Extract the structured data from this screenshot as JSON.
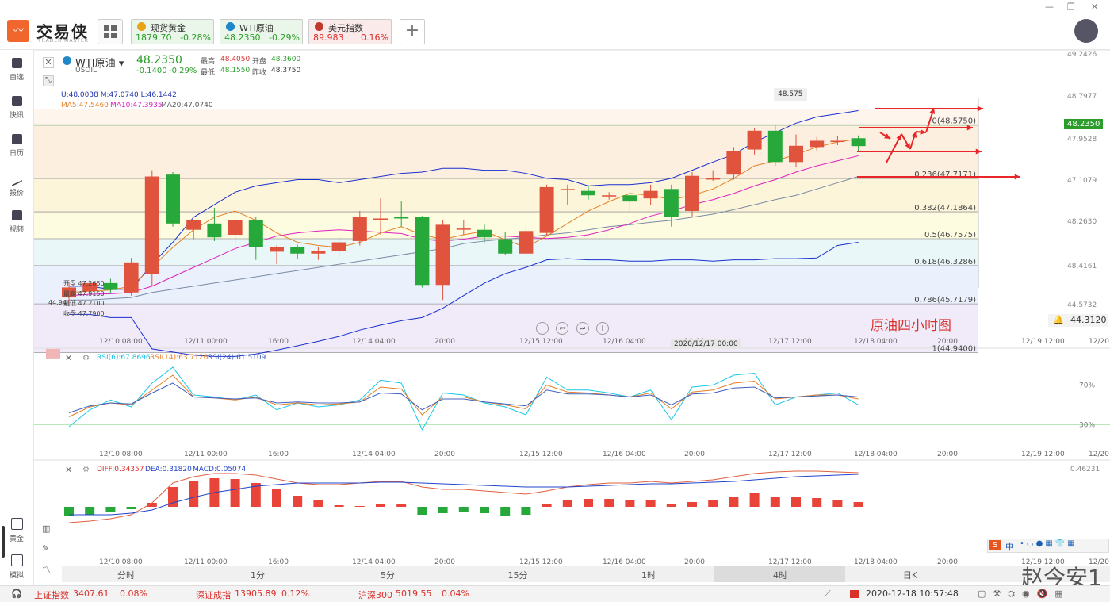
{
  "app": {
    "name": "交易侠",
    "sub": "TRADER MASTER"
  },
  "window": {
    "minimize": "—",
    "restore": "❐",
    "close": "✕"
  },
  "quotes": [
    {
      "name": "现货黄金",
      "price": "1879.70",
      "change": "-0.28%",
      "color": "#e8a317",
      "bg": "#eaf6ea",
      "pc": "#2a9d2a"
    },
    {
      "name": "WTI原油",
      "price": "48.2350",
      "change": "-0.29%",
      "color": "#1e88c8",
      "bg": "#eaf6ea",
      "pc": "#2a9d2a"
    },
    {
      "name": "美元指数",
      "price": "89.983",
      "change": "0.16%",
      "color": "#c0392b",
      "bg": "#fbeaea",
      "pc": "#d9302c"
    }
  ],
  "sidebar": [
    {
      "label": "自选"
    },
    {
      "label": "快讯"
    },
    {
      "label": "日历"
    },
    {
      "label": "报价"
    },
    {
      "label": "视频"
    },
    {
      "label": "黄金"
    },
    {
      "label": "模拟"
    }
  ],
  "symbol": {
    "name": "WTI原油",
    "code": "USOIL",
    "price": "48.2350",
    "change": "-0.1400",
    "pct": "-0.29%",
    "high_l": "最高",
    "high": "48.4050",
    "open_l": "开盘",
    "open": "48.3600",
    "low_l": "最低",
    "low": "48.1550",
    "prev_l": "昨收",
    "prev": "48.3750"
  },
  "indicators": {
    "boll": "U:48.0038   M:47.0740   L:46.1442",
    "ma5": "MA5:47.5460",
    "ma10": "MA10:47.3935",
    "ma20": "MA20:47.0740",
    "rsi6": "RSI(6):67.8696",
    "rsi14": "RSI(14):63.7126",
    "rsi24": "RSI(24):61.5109",
    "diff": "DIFF:0.34357",
    "dea": "DEA:0.31820",
    "macd": "MACD:0.05074"
  },
  "ohlc_box": {
    "open": "开盘 47.2650",
    "high": "最高 47.9150",
    "low": "最低 47.2100",
    "close": "收盘 47.7900",
    "edge": "44.94"
  },
  "fib": [
    {
      "label": "0(48.5750)",
      "price": 48.575
    },
    {
      "label": "0.236(47.7171)",
      "price": 47.7171
    },
    {
      "label": "0.382(47.1864)",
      "price": 47.1864
    },
    {
      "label": "0.5(46.7575)",
      "price": 46.7575
    },
    {
      "label": "0.618(46.3286)",
      "price": 46.3286
    },
    {
      "label": "0.786(45.7179)",
      "price": 45.7179
    },
    {
      "label": "1(44.9400)",
      "price": 44.94
    }
  ],
  "price_axis": [
    "49.2426",
    "48.7977",
    "48.2350",
    "47.9528",
    "47.1079",
    "48.2630",
    "48.4161",
    "44.5732"
  ],
  "price_axis_current": "48.2350",
  "alert_price": "44.3120",
  "peak_label": "48.575",
  "annotation": "原油四小时图",
  "crosshair_date": "2020/12/17 00:00",
  "time_axis": [
    "12/10 08:00",
    "12/11 00:00",
    "16:00",
    "12/14 04:00",
    "20:00",
    "12/15 12:00",
    "12/16 04:00",
    "20:00",
    "12/17 12:00",
    "12/18 04:00",
    "20:00",
    "12/19 12:00",
    "12/20 0"
  ],
  "rsi_levels": [
    "70%",
    "30%"
  ],
  "macd_axis_top": "0.46231",
  "timeframes": [
    "分时",
    "1分",
    "5分",
    "15分",
    "1时",
    "4时",
    "日K"
  ],
  "timeframe_active": "4时",
  "status": {
    "sh_name": "上证指数",
    "sh_val": "3407.61",
    "sh_pct": "0.08%",
    "sz_name": "深证成指",
    "sz_val": "13905.89",
    "sz_pct": "0.12%",
    "hs_name": "沪深300",
    "hs_val": "5019.55",
    "hs_pct": "0.04%",
    "datetime": "2020-12-18 10:57:48"
  },
  "watermark": "赵今安1",
  "ime_label": "中",
  "chart_data": {
    "type": "candlestick",
    "candles": [
      {
        "o": 45.82,
        "h": 46.05,
        "l": 45.68,
        "c": 45.98
      },
      {
        "o": 45.92,
        "h": 46.1,
        "l": 45.85,
        "c": 46.05
      },
      {
        "o": 46.05,
        "h": 46.12,
        "l": 45.88,
        "c": 45.94
      },
      {
        "o": 45.9,
        "h": 46.45,
        "l": 45.85,
        "c": 46.38
      },
      {
        "o": 46.2,
        "h": 47.85,
        "l": 46.0,
        "c": 47.75
      },
      {
        "o": 47.78,
        "h": 47.82,
        "l": 46.95,
        "c": 47.0
      },
      {
        "o": 46.9,
        "h": 47.05,
        "l": 46.75,
        "c": 47.05
      },
      {
        "o": 47.0,
        "h": 47.25,
        "l": 46.72,
        "c": 46.78
      },
      {
        "o": 46.82,
        "h": 47.08,
        "l": 46.68,
        "c": 47.05
      },
      {
        "o": 47.05,
        "h": 47.1,
        "l": 46.42,
        "c": 46.62
      },
      {
        "o": 46.55,
        "h": 46.65,
        "l": 46.35,
        "c": 46.62
      },
      {
        "o": 46.62,
        "h": 46.66,
        "l": 46.44,
        "c": 46.52
      },
      {
        "o": 46.52,
        "h": 46.62,
        "l": 46.42,
        "c": 46.56
      },
      {
        "o": 46.56,
        "h": 46.78,
        "l": 46.48,
        "c": 46.7
      },
      {
        "o": 46.72,
        "h": 47.2,
        "l": 46.65,
        "c": 47.1
      },
      {
        "o": 47.05,
        "h": 47.4,
        "l": 46.82,
        "c": 47.08
      },
      {
        "o": 47.1,
        "h": 47.35,
        "l": 46.95,
        "c": 47.08
      },
      {
        "o": 47.1,
        "h": 47.12,
        "l": 45.98,
        "c": 46.02
      },
      {
        "o": 46.02,
        "h": 47.05,
        "l": 45.78,
        "c": 46.98
      },
      {
        "o": 46.92,
        "h": 47.05,
        "l": 46.82,
        "c": 46.92
      },
      {
        "o": 46.9,
        "h": 46.98,
        "l": 46.7,
        "c": 46.78
      },
      {
        "o": 46.75,
        "h": 46.86,
        "l": 46.5,
        "c": 46.52
      },
      {
        "o": 46.52,
        "h": 46.95,
        "l": 46.5,
        "c": 46.88
      },
      {
        "o": 46.85,
        "h": 47.62,
        "l": 46.8,
        "c": 47.58
      },
      {
        "o": 47.55,
        "h": 47.62,
        "l": 47.3,
        "c": 47.55
      },
      {
        "o": 47.52,
        "h": 47.6,
        "l": 47.38,
        "c": 47.45
      },
      {
        "o": 47.45,
        "h": 47.5,
        "l": 47.38,
        "c": 47.45
      },
      {
        "o": 47.45,
        "h": 47.5,
        "l": 47.2,
        "c": 47.35
      },
      {
        "o": 47.4,
        "h": 47.62,
        "l": 47.3,
        "c": 47.52
      },
      {
        "o": 47.55,
        "h": 47.62,
        "l": 46.95,
        "c": 47.1
      },
      {
        "o": 47.2,
        "h": 47.82,
        "l": 47.1,
        "c": 47.76
      },
      {
        "o": 47.72,
        "h": 47.85,
        "l": 47.68,
        "c": 47.72
      },
      {
        "o": 47.78,
        "h": 48.22,
        "l": 47.7,
        "c": 48.15
      },
      {
        "o": 48.18,
        "h": 48.52,
        "l": 48.1,
        "c": 48.48
      },
      {
        "o": 48.48,
        "h": 48.575,
        "l": 47.92,
        "c": 47.98
      },
      {
        "o": 47.98,
        "h": 48.42,
        "l": 47.9,
        "c": 48.24
      },
      {
        "o": 48.22,
        "h": 48.38,
        "l": 48.15,
        "c": 48.32
      },
      {
        "o": 48.3,
        "h": 48.4,
        "l": 48.25,
        "c": 48.32
      },
      {
        "o": 48.36,
        "h": 48.405,
        "l": 48.155,
        "c": 48.235
      }
    ],
    "boll_upper": [
      46.0,
      46.0,
      45.95,
      45.95,
      46.35,
      46.7,
      47.1,
      47.3,
      47.5,
      47.6,
      47.65,
      47.7,
      47.7,
      47.65,
      47.7,
      47.75,
      47.8,
      47.82,
      47.88,
      47.88,
      47.85,
      47.85,
      47.8,
      47.72,
      47.7,
      47.6,
      47.62,
      47.62,
      47.65,
      47.72,
      47.85,
      47.98,
      48.1,
      48.3,
      48.45,
      48.6,
      48.7,
      48.75,
      48.8
    ],
    "boll_lower": [
      45.55,
      45.55,
      45.5,
      45.5,
      45.0,
      44.95,
      44.9,
      44.88,
      44.88,
      44.92,
      44.98,
      45.05,
      45.12,
      45.2,
      45.3,
      45.38,
      45.45,
      45.5,
      45.65,
      45.85,
      46.05,
      46.2,
      46.3,
      46.42,
      46.44,
      46.42,
      46.42,
      46.4,
      46.4,
      46.42,
      46.42,
      46.4,
      46.42,
      46.42,
      46.44,
      46.44,
      46.45,
      46.65,
      46.7
    ],
    "boll_mid": [
      45.78,
      45.78,
      45.8,
      45.82,
      45.9,
      45.95,
      46.0,
      46.05,
      46.1,
      46.15,
      46.2,
      46.25,
      46.3,
      46.35,
      46.4,
      46.45,
      46.5,
      46.55,
      46.6,
      46.68,
      46.72,
      46.75,
      46.78,
      46.82,
      46.85,
      46.9,
      46.95,
      46.98,
      47.02,
      47.05,
      47.1,
      47.15,
      47.22,
      47.3,
      47.38,
      47.45,
      47.55,
      47.65,
      47.75
    ],
    "ma5": [
      45.9,
      45.92,
      45.94,
      46.0,
      46.3,
      46.62,
      46.9,
      47.1,
      47.2,
      47.05,
      46.85,
      46.7,
      46.65,
      46.62,
      46.7,
      46.85,
      46.95,
      46.82,
      46.75,
      46.82,
      46.88,
      46.74,
      46.62,
      46.8,
      47.0,
      47.2,
      47.35,
      47.48,
      47.45,
      47.38,
      47.45,
      47.55,
      47.72,
      47.92,
      48.0,
      48.1,
      48.22,
      48.3,
      48.35
    ],
    "ma10": [
      45.85,
      45.87,
      45.88,
      45.9,
      46.0,
      46.15,
      46.3,
      46.45,
      46.6,
      46.7,
      46.8,
      46.85,
      46.88,
      46.9,
      46.88,
      46.86,
      46.84,
      46.75,
      46.72,
      46.75,
      46.8,
      46.8,
      46.78,
      46.76,
      46.78,
      46.82,
      46.9,
      47.0,
      47.12,
      47.2,
      47.3,
      47.38,
      47.48,
      47.6,
      47.7,
      47.82,
      47.92,
      48.0,
      48.08
    ],
    "rsi6": [
      28,
      45,
      55,
      48,
      72,
      88,
      60,
      58,
      55,
      60,
      45,
      52,
      48,
      50,
      55,
      75,
      72,
      25,
      62,
      60,
      52,
      48,
      40,
      78,
      65,
      65,
      62,
      58,
      65,
      35,
      68,
      70,
      80,
      82,
      50,
      58,
      60,
      62,
      50
    ],
    "rsi14": [
      38,
      48,
      52,
      50,
      65,
      80,
      58,
      57,
      55,
      58,
      50,
      52,
      50,
      51,
      53,
      68,
      66,
      40,
      58,
      58,
      53,
      50,
      46,
      70,
      63,
      62,
      60,
      58,
      62,
      46,
      63,
      65,
      72,
      74,
      56,
      58,
      60,
      60,
      56
    ],
    "rsi24": [
      42,
      49,
      52,
      51,
      62,
      72,
      58,
      57,
      56,
      57,
      52,
      53,
      52,
      52,
      53,
      62,
      61,
      45,
      56,
      56,
      53,
      51,
      49,
      65,
      61,
      61,
      60,
      58,
      60,
      50,
      61,
      62,
      67,
      68,
      57,
      58,
      59,
      60,
      58
    ],
    "macd_hist": [
      -0.12,
      -0.1,
      -0.06,
      -0.03,
      0.05,
      0.25,
      0.32,
      0.36,
      0.35,
      0.3,
      0.22,
      0.14,
      0.08,
      0.02,
      0.01,
      0.03,
      0.04,
      -0.1,
      -0.08,
      -0.06,
      -0.08,
      -0.12,
      -0.1,
      0.03,
      0.08,
      0.1,
      0.1,
      0.09,
      0.09,
      0.04,
      0.06,
      0.08,
      0.12,
      0.18,
      0.12,
      0.12,
      0.11,
      0.09,
      0.06
    ],
    "macd_diff": [
      -0.2,
      -0.18,
      -0.15,
      -0.1,
      0.05,
      0.3,
      0.38,
      0.42,
      0.42,
      0.4,
      0.35,
      0.3,
      0.28,
      0.28,
      0.3,
      0.32,
      0.32,
      0.25,
      0.22,
      0.22,
      0.2,
      0.18,
      0.16,
      0.2,
      0.25,
      0.28,
      0.3,
      0.3,
      0.32,
      0.3,
      0.32,
      0.34,
      0.38,
      0.42,
      0.44,
      0.45,
      0.45,
      0.44,
      0.43
    ],
    "macd_dea": [
      -0.1,
      -0.1,
      -0.1,
      -0.08,
      -0.04,
      0.05,
      0.12,
      0.18,
      0.22,
      0.26,
      0.28,
      0.3,
      0.3,
      0.3,
      0.3,
      0.31,
      0.31,
      0.3,
      0.29,
      0.28,
      0.27,
      0.26,
      0.25,
      0.25,
      0.25,
      0.26,
      0.27,
      0.28,
      0.29,
      0.29,
      0.3,
      0.31,
      0.32,
      0.34,
      0.36,
      0.38,
      0.39,
      0.4,
      0.41
    ]
  }
}
